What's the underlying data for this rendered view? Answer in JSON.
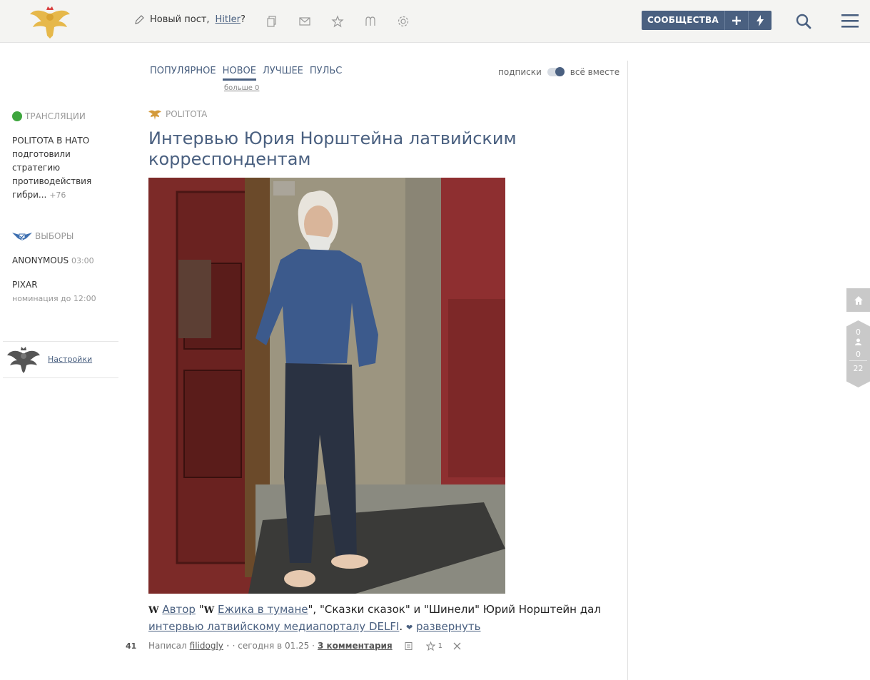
{
  "header": {
    "new_post_label": "Новый пост,",
    "username": "Hitler",
    "question_mark": "?",
    "communities_label": "СООБЩЕСТВА"
  },
  "sidebar": {
    "broadcasts_label": "ТРАНСЛЯЦИИ",
    "broadcast_title": "POLITOTA В НАТО",
    "broadcast_text": "подготовили стратегию противодействия гибри...",
    "broadcast_count": "+76",
    "elections_label": "ВЫБОРЫ",
    "election_1_title": "ANONYMOUS",
    "election_1_time": "03:00",
    "election_2_title": "PIXAR",
    "election_2_text": "номинация до 12:00",
    "settings_link": "Настройки"
  },
  "feed": {
    "tabs": [
      "ПОПУЛЯРНОЕ",
      "НОВОЕ",
      "ЛУЧШЕЕ",
      "ПУЛЬС"
    ],
    "active_tab": "НОВОЕ",
    "more_link": "больше 0",
    "toggle_left": "подписки",
    "toggle_right": "всё вместе"
  },
  "post": {
    "community": "POLITOTA",
    "title": "Интервью Юрия Норштейна латвийским корреспондентам",
    "body_w1": "W",
    "body_link_author": "Автор",
    "body_text_1": " \"",
    "body_w2": "W",
    "body_link_hedgehog": "Ежика в тумане",
    "body_text_2": "\", \"Сказки сказок\" и \"Шинели\" Юрий Норштейн дал ",
    "body_link_interview": "интервью латвийскому медиапорталу DELFI",
    "body_text_3": ".",
    "expand_link": "развернуть",
    "score": "41",
    "author_prefix": "Написал",
    "author": "filidogly",
    "time": "· сегодня в 01.25 ·",
    "comments_link": "3 комментария",
    "favorites_count": "1"
  },
  "widgets": {
    "counter_top": "0",
    "counter_mid": "0",
    "counter_bottom": "22"
  },
  "colors": {
    "accent": "#4a6080",
    "green": "#3ea63e"
  }
}
